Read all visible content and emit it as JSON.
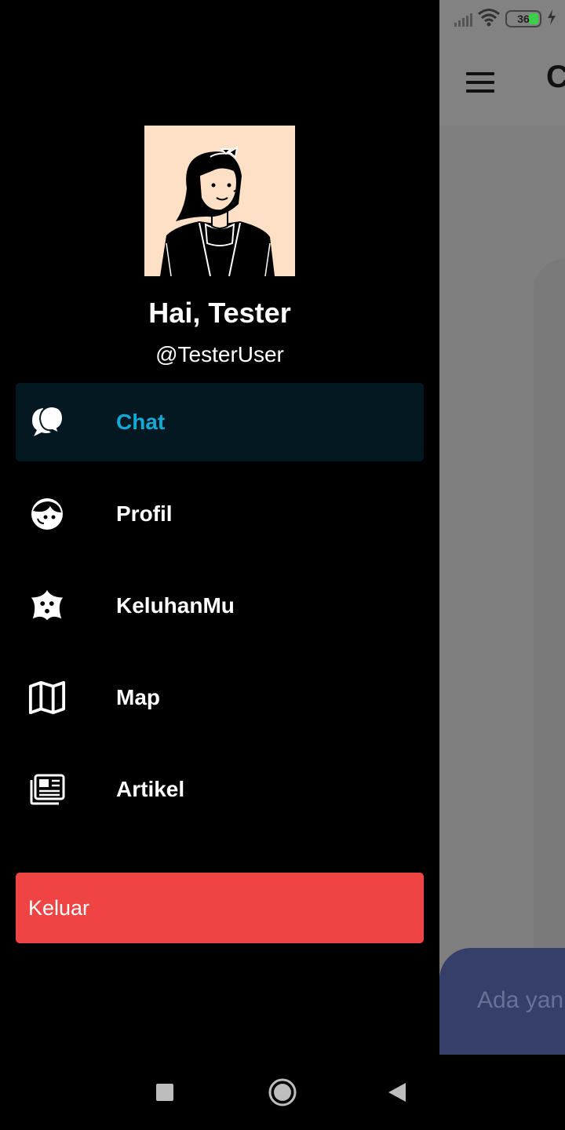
{
  "background_app": {
    "title_partial": "C",
    "input_placeholder_partial": "Ada yan"
  },
  "status_bar": {
    "battery_level": "36",
    "battery_color": "#3ccf4a"
  },
  "drawer": {
    "greeting": "Hai, Tester",
    "username": "@TesterUser",
    "active_color": "#12a9d6",
    "menu": [
      {
        "label": "Chat",
        "icon": "chat-bubbles-icon",
        "active": true
      },
      {
        "label": "Profil",
        "icon": "face-icon",
        "active": false
      },
      {
        "label": "KeluhanMu",
        "icon": "star-face-icon",
        "active": false
      },
      {
        "label": "Map",
        "icon": "map-icon",
        "active": false
      },
      {
        "label": "Artikel",
        "icon": "newspaper-icon",
        "active": false
      }
    ],
    "logout_label": "Keluar",
    "logout_color": "#ef4444"
  },
  "nav_bar": {
    "buttons": [
      "recent-apps-icon",
      "home-icon",
      "back-icon"
    ]
  }
}
